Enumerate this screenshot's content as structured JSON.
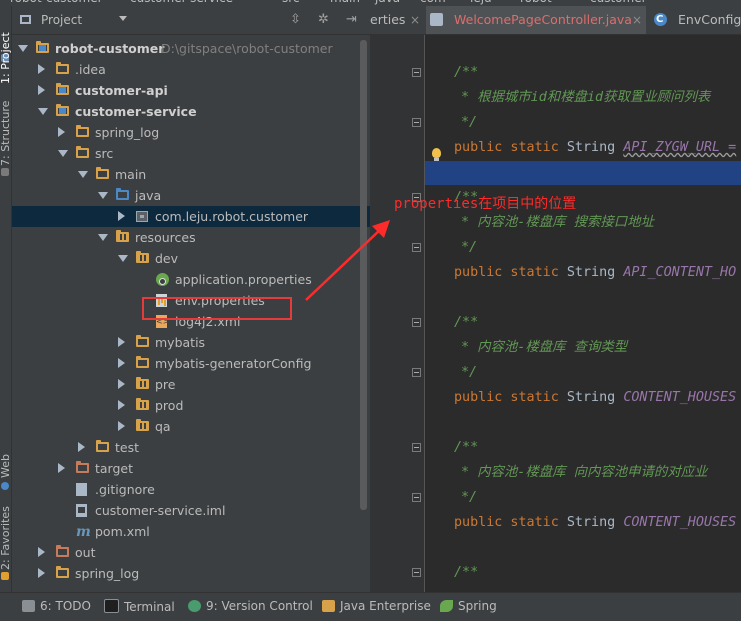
{
  "top_breadcrumb": [
    "robot-customer",
    "customer-service",
    "src",
    "main",
    "java",
    "com",
    "leju",
    "robot",
    "customer"
  ],
  "left_strip": {
    "project_label": "1: Project",
    "structure_label": "7: Structure",
    "web_label": "Web",
    "favorites_label": "2: Favorites"
  },
  "panel": {
    "title": "Project",
    "toolbar_icons": [
      "scroll-icon",
      "settings-icon",
      "hide-icon"
    ]
  },
  "tree": [
    {
      "label": "robot-customer",
      "path": "D:\\gitspace\\robot-customer",
      "icon": "module-folder-icon",
      "expanded": true,
      "bold": true
    },
    {
      "label": ".idea",
      "icon": "folder-icon",
      "expanded": false
    },
    {
      "label": "customer-api",
      "icon": "module-folder-icon",
      "expanded": false,
      "bold": true
    },
    {
      "label": "customer-service",
      "icon": "module-folder-icon",
      "expanded": true,
      "bold": true
    },
    {
      "label": "spring_log",
      "icon": "folder-icon",
      "expanded": false
    },
    {
      "label": "src",
      "icon": "folder-icon",
      "expanded": true
    },
    {
      "label": "main",
      "icon": "folder-icon",
      "expanded": true
    },
    {
      "label": "java",
      "icon": "source-folder-icon",
      "expanded": true
    },
    {
      "label": "com.leju.robot.customer",
      "icon": "package-icon",
      "expanded": false,
      "selected": true
    },
    {
      "label": "resources",
      "icon": "resources-folder-icon",
      "expanded": true
    },
    {
      "label": "dev",
      "icon": "resources-folder-icon",
      "expanded": true
    },
    {
      "label": "application.properties",
      "icon": "spring-properties-icon"
    },
    {
      "label": "env.properties",
      "icon": "properties-file-icon",
      "highlighted": true
    },
    {
      "label": "log4j2.xml",
      "icon": "xml-file-icon"
    },
    {
      "label": "mybatis",
      "icon": "folder-icon",
      "expanded": false
    },
    {
      "label": "mybatis-generatorConfig",
      "icon": "folder-icon",
      "expanded": false
    },
    {
      "label": "pre",
      "icon": "resources-folder-icon",
      "expanded": false
    },
    {
      "label": "prod",
      "icon": "resources-folder-icon",
      "expanded": false
    },
    {
      "label": "qa",
      "icon": "resources-folder-icon",
      "expanded": false
    },
    {
      "label": "test",
      "icon": "folder-icon",
      "expanded": false
    },
    {
      "label": "target",
      "icon": "excluded-folder-icon",
      "expanded": false
    },
    {
      "label": ".gitignore",
      "icon": "gitignore-file-icon"
    },
    {
      "label": "customer-service.iml",
      "icon": "iml-file-icon"
    },
    {
      "label": "pom.xml",
      "icon": "maven-icon"
    },
    {
      "label": "out",
      "icon": "excluded-folder-icon",
      "expanded": false
    },
    {
      "label": "spring_log",
      "icon": "folder-icon",
      "expanded": false
    }
  ],
  "editor_tabs": [
    {
      "label": "erties",
      "icon": "file-icon",
      "active": false
    },
    {
      "label": "WelcomePageController.java",
      "icon": "class-icon",
      "active": true,
      "color": "#e06c6c"
    },
    {
      "label": "EnvConfig.",
      "icon": "class-icon",
      "active": false
    }
  ],
  "code": {
    "blocks": [
      {
        "comment": "* 根据城市id和楼盘id获取置业顾问列表",
        "modifiers": "public static",
        "type": "String",
        "field": "API_ZYGW_URL ="
      },
      {
        "comment": "* 内容池-楼盘库 搜索接口地址",
        "modifiers": "public static",
        "type": "String",
        "field": "API_CONTENT_HO"
      },
      {
        "comment": "* 内容池-楼盘库 查询类型",
        "modifiers": "public static",
        "type": "String",
        "field": "CONTENT_HOUSES"
      },
      {
        "comment": "* 内容池-楼盘库 向内容池申请的对应业",
        "modifiers": "public static",
        "type": "String",
        "field": "CONTENT_HOUSES"
      }
    ],
    "comment_open": "/**",
    "comment_close": "*/",
    "last_comment_open": "/**"
  },
  "annotation": {
    "text": "properties在项目中的位置",
    "color": "#ff2b2b"
  },
  "bottom_tools": [
    {
      "label": "6: TODO",
      "icon": "todo-icon"
    },
    {
      "label": "Terminal",
      "icon": "terminal-icon"
    },
    {
      "label": "9: Version Control",
      "icon": "vcs-icon"
    },
    {
      "label": "Java Enterprise",
      "icon": "java-enterprise-icon"
    },
    {
      "label": "Spring",
      "icon": "spring-icon"
    }
  ]
}
